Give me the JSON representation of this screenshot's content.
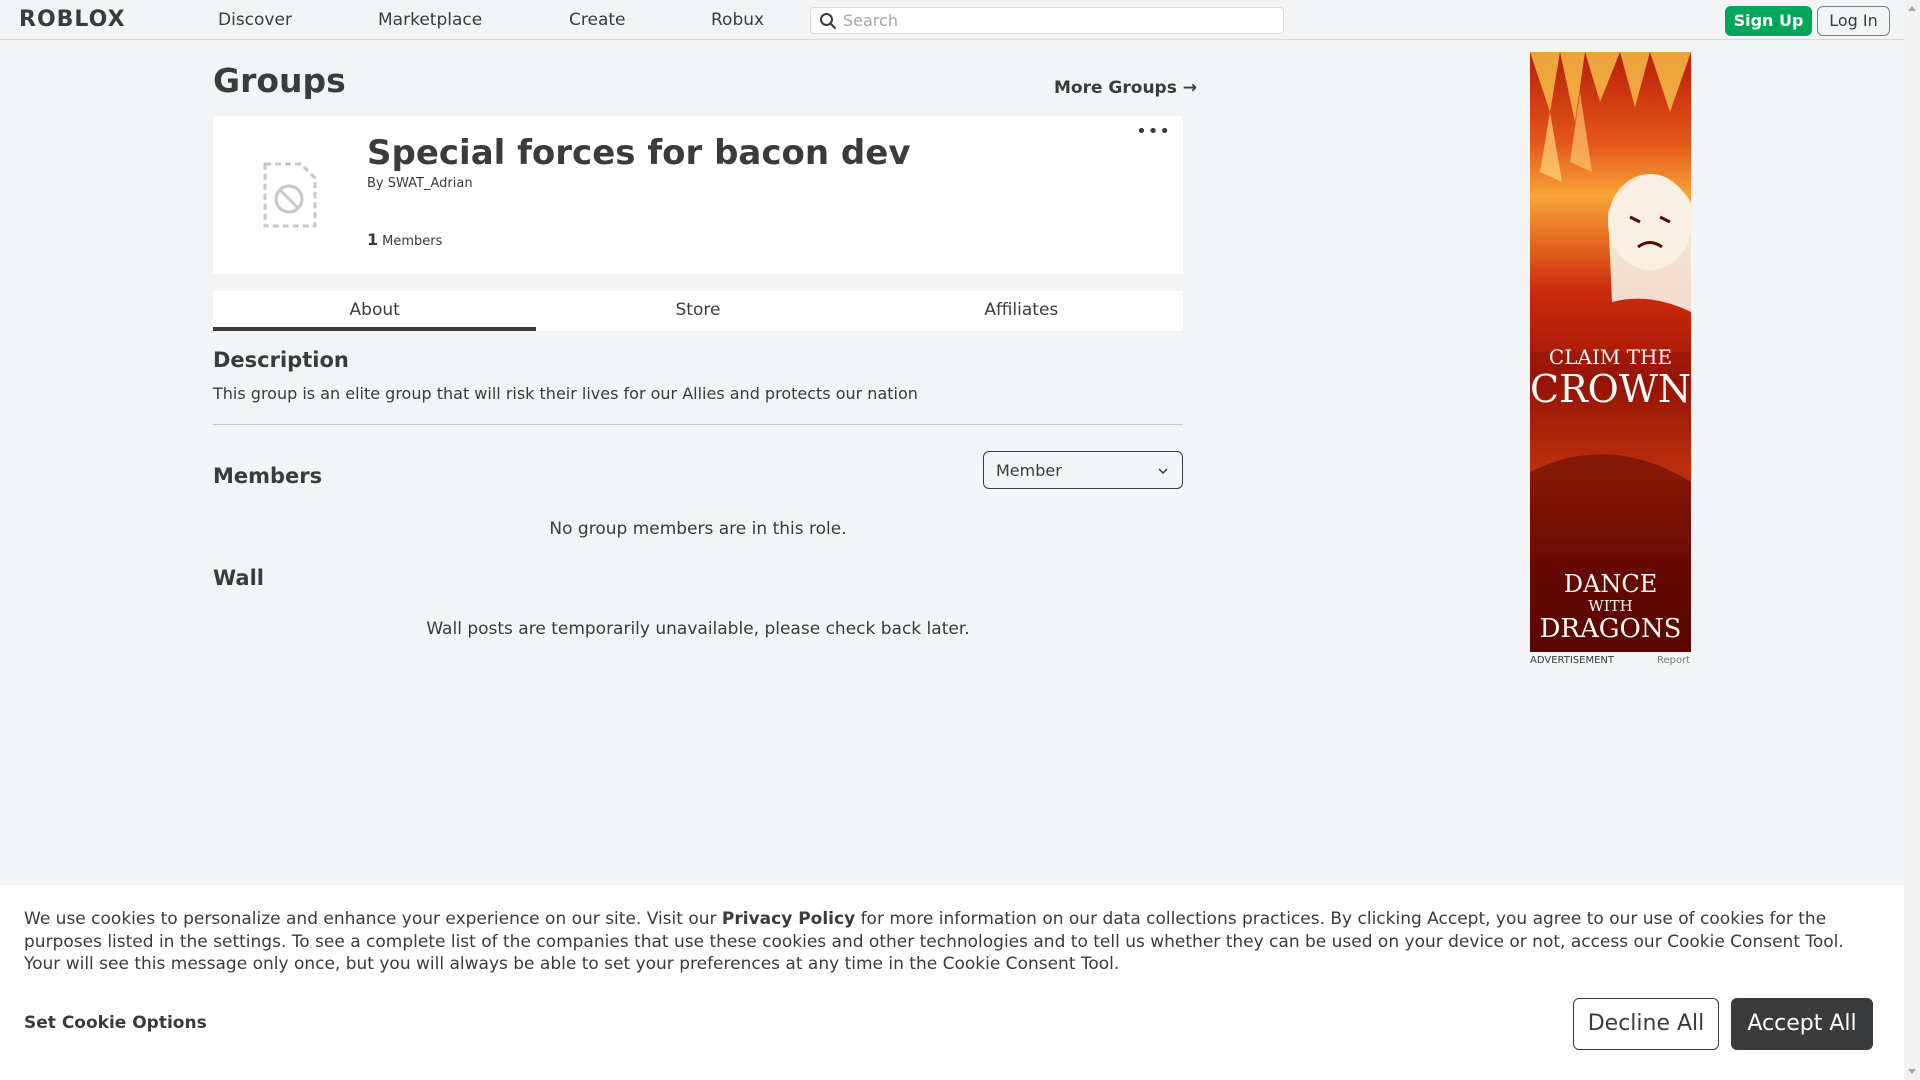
{
  "nav": {
    "logo": "ROBLOX",
    "links": [
      "Discover",
      "Marketplace",
      "Create",
      "Robux"
    ],
    "search_placeholder": "Search",
    "signup_label": "Sign Up",
    "login_label": "Log In"
  },
  "page": {
    "title": "Groups",
    "more_groups": "More Groups →"
  },
  "group": {
    "name": "Special forces for bacon dev",
    "owner_prefix": "By",
    "owner": "SWAT_Adrian",
    "member_count": "1",
    "member_label": "Members",
    "more_menu": "•••"
  },
  "tabs": [
    {
      "label": "About",
      "active": true
    },
    {
      "label": "Store",
      "active": false
    },
    {
      "label": "Affiliates",
      "active": false
    }
  ],
  "about": {
    "description_title": "Description",
    "description_text": "This group is an elite group that will risk their lives for our Allies and protects our nation",
    "members_title": "Members",
    "role_selected": "Member",
    "members_empty": "No group members are in this role.",
    "wall_title": "Wall",
    "wall_empty": "Wall posts are temporarily unavailable, please check back later."
  },
  "ad": {
    "line1": "CLAIM THE",
    "line2": "CROWN",
    "line3": "DANCE",
    "line4": "WITH",
    "line5": "DRAGONS",
    "label": "ADVERTISEMENT",
    "report": "Report"
  },
  "cookie": {
    "text_before": "We use cookies to personalize and enhance your experience on our site. Visit our ",
    "policy_link": "Privacy Policy",
    "text_after": " for more information on our data collections practices. By clicking Accept, you agree to our use of cookies for the purposes listed in the settings. To see a complete list of the companies that use these cookies and other technologies and to tell us whether they can be used on your device or not, access our Cookie Consent Tool. Your will see this message only once, but you will always be able to set your preferences at any time in the Cookie Consent Tool.",
    "options_label": "Set Cookie Options",
    "decline_label": "Decline All",
    "accept_label": "Accept All"
  },
  "colors": {
    "signup_green": "#00a65a",
    "text_primary": "#393b3d",
    "page_bg": "#f2f4f5"
  }
}
